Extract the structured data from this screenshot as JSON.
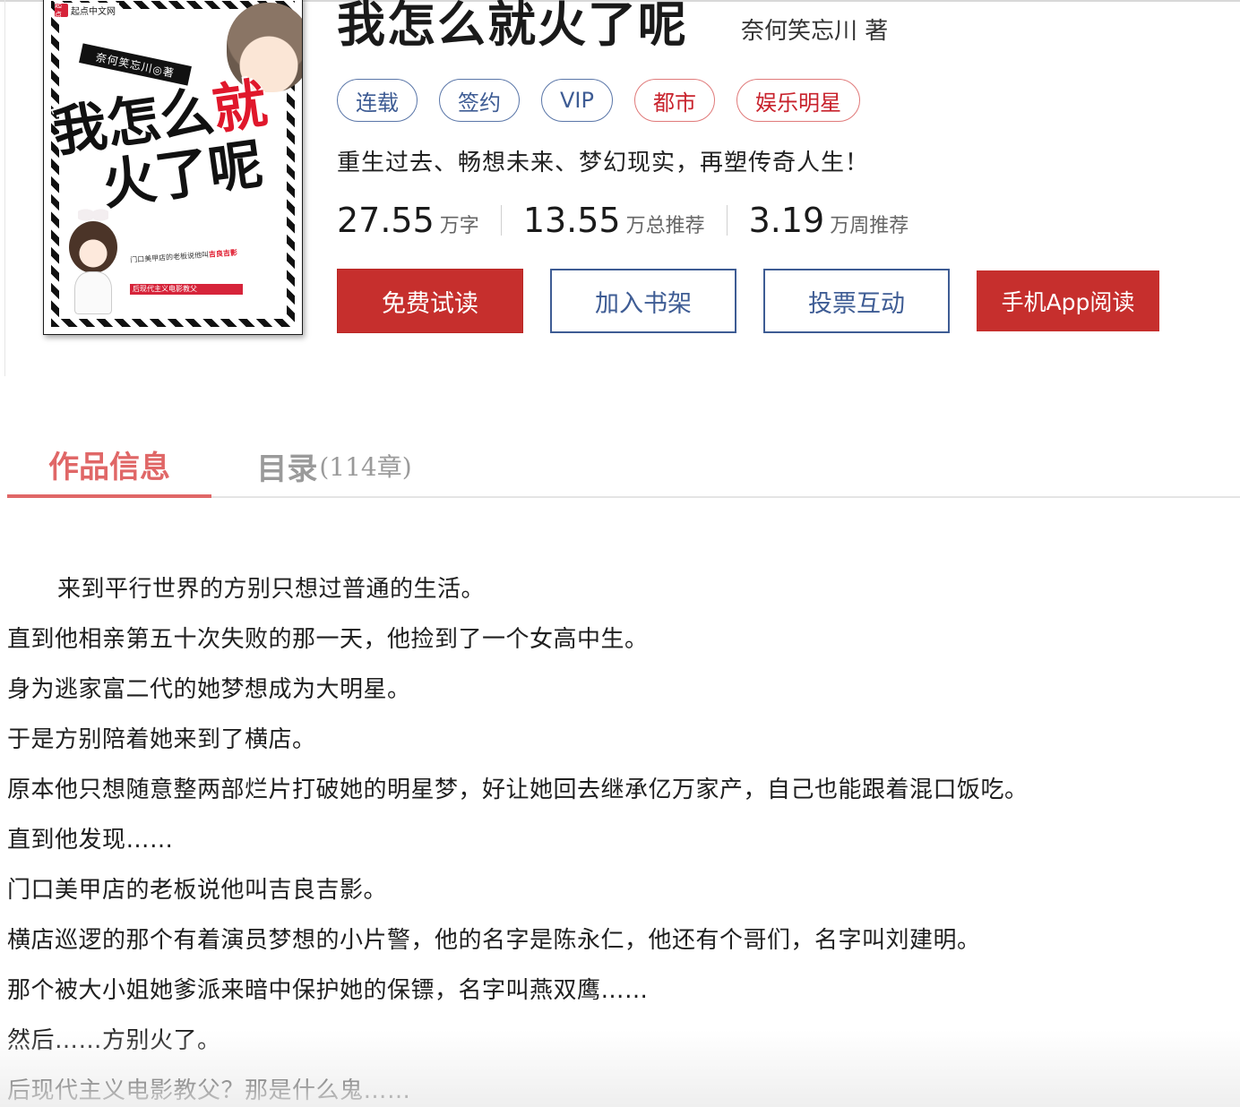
{
  "book": {
    "title": "我怎么就火了呢",
    "author": "奈何笑忘川 著",
    "tags": [
      {
        "label": "连载",
        "color": "#3e5c94"
      },
      {
        "label": "签约",
        "color": "#3e5c94"
      },
      {
        "label": "VIP",
        "color": "#3e5c94"
      },
      {
        "label": "都市",
        "color": "#c8222c"
      },
      {
        "label": "娱乐明星",
        "color": "#c8222c"
      }
    ],
    "intro": "重生过去、畅想未来、梦幻现实，再塑传奇人生！",
    "stats": [
      {
        "value": "27.55",
        "unit": "万字"
      },
      {
        "value": "13.55",
        "unit": "万总推荐"
      },
      {
        "value": "3.19",
        "unit": "万周推荐"
      }
    ]
  },
  "cover": {
    "publisher": "起点中文网",
    "publisher_logo": "起点",
    "author_strip": "奈何笑忘川◎著",
    "art_title": {
      "part1": "我怎么",
      "part1_red": "就",
      "part2": "火了",
      "part2_end": "呢"
    },
    "blurb_text": "门口美甲店的老板说他叫",
    "blurb_highlight": "吉良吉影",
    "tagline": "后现代主义电影教父"
  },
  "actions": {
    "read_free": "免费试读",
    "add_shelf": "加入书架",
    "vote": "投票互动",
    "app_read": "手机App阅读"
  },
  "tabs": {
    "info": "作品信息",
    "catalog": "目录",
    "catalog_count": "(114章)"
  },
  "synopsis": [
    "来到平行世界的方别只想过普通的生活。",
    "直到他相亲第五十次失败的那一天，他捡到了一个女高中生。",
    "身为逃家富二代的她梦想成为大明星。",
    "于是方别陪着她来到了横店。",
    "原本他只想随意整两部烂片打破她的明星梦，好让她回去继承亿万家产，自己也能跟着混口饭吃。",
    "直到他发现……",
    "门口美甲店的老板说他叫吉良吉影。",
    "横店巡逻的那个有着演员梦想的小片警，他的名字是陈永仁，他还有个哥们，名字叫刘建明。",
    "那个被大小姐她爹派来暗中保护她的保镖，名字叫燕双鹰……",
    "然后……方别火了。",
    "后现代主义电影教父？那是什么鬼……"
  ],
  "colors": {
    "accent_red": "#c62f2d",
    "tab_active": "#e06767",
    "link_blue": "#3e5c94"
  }
}
